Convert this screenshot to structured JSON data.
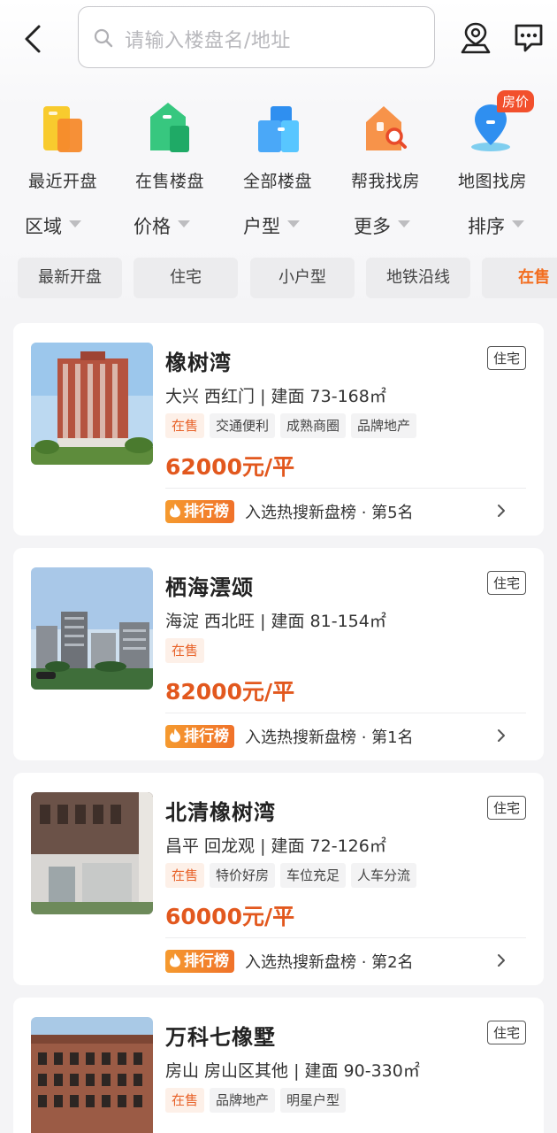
{
  "header": {
    "back_icon": "chevron-left-icon",
    "search_placeholder": "请输入楼盘名/地址",
    "consultant_icon": "person-pin-icon",
    "message_icon": "chat-bubble-icon"
  },
  "categories": [
    {
      "label": "最近开盘",
      "icon": "recent-open-icon"
    },
    {
      "label": "在售楼盘",
      "icon": "on-sale-building-icon"
    },
    {
      "label": "全部楼盘",
      "icon": "all-buildings-icon"
    },
    {
      "label": "帮我找房",
      "icon": "house-search-icon"
    },
    {
      "label": "地图找房",
      "icon": "map-pin-icon",
      "badge": "房价"
    }
  ],
  "filters": [
    "区域",
    "价格",
    "户型",
    "更多",
    "排序"
  ],
  "chips": [
    "最新开盘",
    "住宅",
    "小户型",
    "地铁沿线",
    "在售"
  ],
  "listings": [
    {
      "name": "橡树湾",
      "type": "住宅",
      "location": "大兴 西红门 | 建面 73-168㎡",
      "status": "在售",
      "tags": [
        "交通便利",
        "成熟商圈",
        "品牌地产"
      ],
      "price": "62000元/平",
      "rank_badge": "排行榜",
      "rank_text": "入选热搜新盘榜 · 第5名"
    },
    {
      "name": "栖海澐颂",
      "type": "住宅",
      "location": "海淀 西北旺 | 建面 81-154㎡",
      "status": "在售",
      "tags": [],
      "price": "82000元/平",
      "rank_badge": "排行榜",
      "rank_text": "入选热搜新盘榜 · 第1名"
    },
    {
      "name": "北清橡树湾",
      "type": "住宅",
      "location": "昌平 回龙观 | 建面 72-126㎡",
      "status": "在售",
      "tags": [
        "特价好房",
        "车位充足",
        "人车分流"
      ],
      "price": "60000元/平",
      "rank_badge": "排行榜",
      "rank_text": "入选热搜新盘榜 · 第2名"
    },
    {
      "name": "万科七橡墅",
      "type": "住宅",
      "location": "房山 房山区其他 | 建面 90-330㎡",
      "status": "在售",
      "tags": [
        "品牌地产",
        "明星户型"
      ]
    }
  ],
  "colors": {
    "accent": "#e2581e",
    "badge_red": "#f2502d",
    "rank_orange": "#f0722a"
  }
}
